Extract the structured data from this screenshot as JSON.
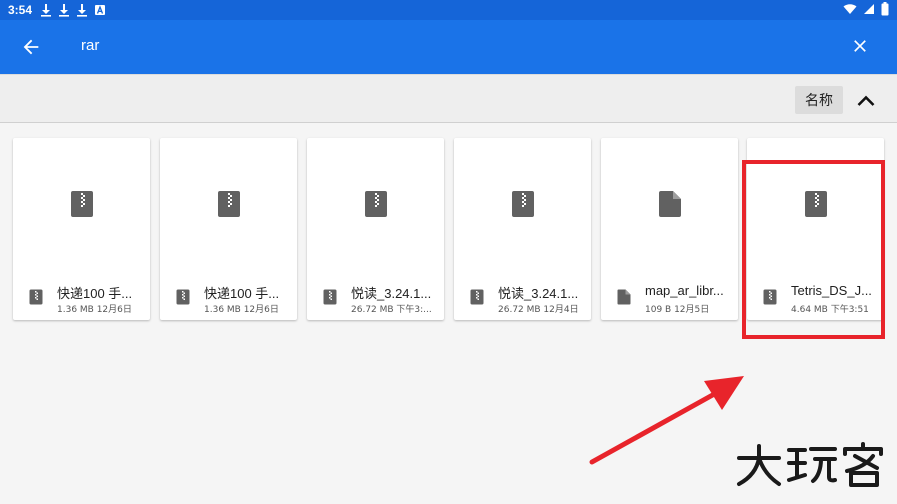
{
  "status_bar": {
    "time": "3:54",
    "left_icons": [
      "download-icon",
      "download-icon",
      "download-icon",
      "a-icon"
    ],
    "right_icons": [
      "wifi-icon",
      "signal-icon",
      "battery-icon"
    ]
  },
  "app_bar": {
    "query": "rar",
    "back_icon": "arrow-left-icon",
    "close_icon": "close-icon"
  },
  "sort_bar": {
    "label": "名称",
    "direction_icon": "chevron-up-icon"
  },
  "files": [
    {
      "name": "快递100 手...",
      "info": "1.36 MB 12月6日",
      "type": "archive"
    },
    {
      "name": "快递100 手...",
      "info": "1.36 MB 12月6日",
      "type": "archive"
    },
    {
      "name": "悦读_3.24.1...",
      "info": "26.72 MB 下午3:...",
      "type": "archive"
    },
    {
      "name": "悦读_3.24.1...",
      "info": "26.72 MB 12月4日",
      "type": "archive"
    },
    {
      "name": "map_ar_libr...",
      "info": "109 B 12月5日",
      "type": "file"
    },
    {
      "name": "Tetris_DS_J...",
      "info": "4.64 MB 下午3:51",
      "type": "archive"
    }
  ],
  "colors": {
    "status_bar": "#1565d8",
    "app_bar": "#1a73e8",
    "highlight": "#e8242b",
    "icon_gray": "#616161"
  },
  "watermark": "大玩客"
}
